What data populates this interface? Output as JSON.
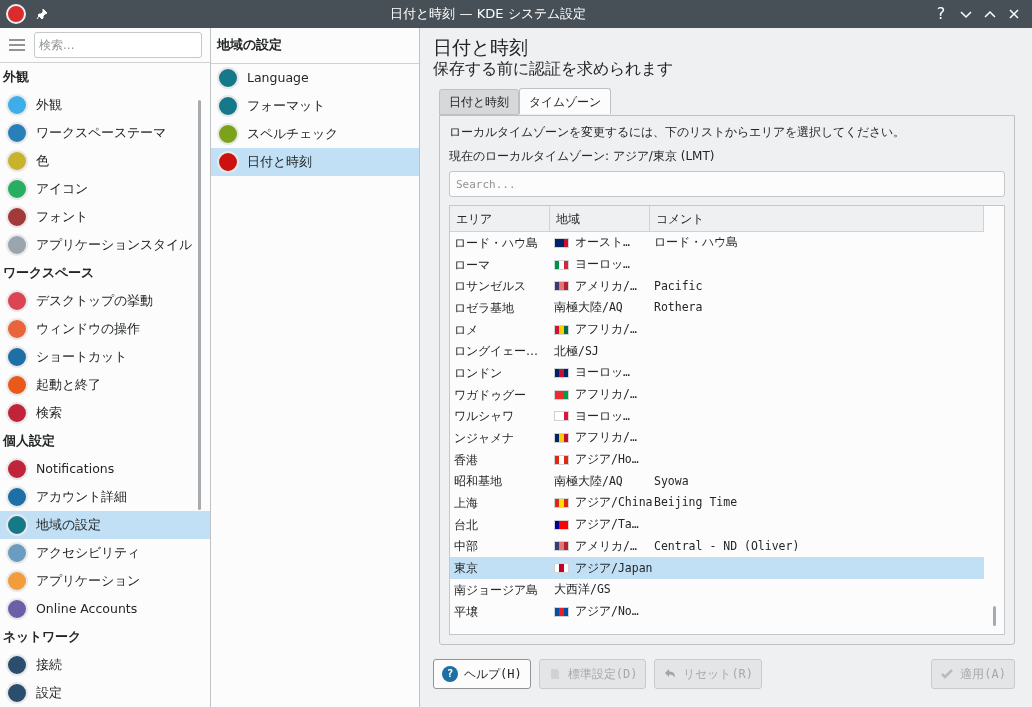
{
  "window": {
    "title": "日付と時刻 — KDE システム設定",
    "help_glyph": "?"
  },
  "sidebar": {
    "search_placeholder": "検索...",
    "sections": [
      {
        "heading": "外観",
        "items": [
          {
            "label": "外観",
            "color": "#3daee9",
            "selected": false
          },
          {
            "label": "ワークスペーステーマ",
            "color": "#2980b9",
            "selected": false
          },
          {
            "label": "色",
            "color": "#c9b22c",
            "selected": false
          },
          {
            "label": "アイコン",
            "color": "#27ae60",
            "selected": false
          },
          {
            "label": "フォント",
            "color": "#a33a3a",
            "selected": false
          },
          {
            "label": "アプリケーションスタイル",
            "color": "#9aa5ad",
            "selected": false
          }
        ]
      },
      {
        "heading": "ワークスペース",
        "items": [
          {
            "label": "デスクトップの挙動",
            "color": "#da4453",
            "selected": false
          },
          {
            "label": "ウィンドウの操作",
            "color": "#e9643a",
            "selected": false
          },
          {
            "label": "ショートカット",
            "color": "#1d6fa5",
            "selected": false
          },
          {
            "label": "起動と終了",
            "color": "#e8591a",
            "selected": false
          },
          {
            "label": "検索",
            "color": "#c0233a",
            "selected": false
          }
        ]
      },
      {
        "heading": "個人設定",
        "items": [
          {
            "label": "Notifications",
            "color": "#c0233a",
            "selected": false
          },
          {
            "label": "アカウント詳細",
            "color": "#1d6fa5",
            "selected": false
          },
          {
            "label": "地域の設定",
            "color": "#16798a",
            "selected": true
          },
          {
            "label": "アクセシビリティ",
            "color": "#6a9cc0",
            "selected": false
          },
          {
            "label": "アプリケーション",
            "color": "#f39c3c",
            "selected": false
          },
          {
            "label": "Online Accounts",
            "color": "#6b5fa8",
            "selected": false
          }
        ]
      },
      {
        "heading": "ネットワーク",
        "items": [
          {
            "label": "接続",
            "color": "#2c4e6e",
            "selected": false
          },
          {
            "label": "設定",
            "color": "#2c4e6e",
            "selected": false
          }
        ]
      }
    ]
  },
  "subpanel": {
    "title": "地域の設定",
    "items": [
      {
        "label": "Language",
        "color": "#16798a",
        "selected": false
      },
      {
        "label": "フォーマット",
        "color": "#16798a",
        "selected": false
      },
      {
        "label": "スペルチェック",
        "color": "#7ca11a",
        "selected": false
      },
      {
        "label": "日付と時刻",
        "color": "#cc1111",
        "selected": true
      }
    ]
  },
  "page": {
    "title": "日付と時刻",
    "subtitle": "保存する前に認証を求められます",
    "tabs": [
      {
        "label": "日付と時刻",
        "selected": false
      },
      {
        "label": "タイムゾーン",
        "selected": true
      }
    ],
    "instruction": "ローカルタイムゾーンを変更するには、下のリストからエリアを選択してください。",
    "current": "現在のローカルタイムゾーン: アジア/東京 (LMT)",
    "search_placeholder": "Search...",
    "table": {
      "columns": [
        "エリア",
        "地域",
        "コメント"
      ],
      "rows": [
        {
          "area": "ロード・ハウ島",
          "flag": [
            {
              "color": "#012169"
            },
            {
              "color": "#012169"
            },
            {
              "color": "#c8102e"
            }
          ],
          "region": "オースト…",
          "comment": "ロード・ハウ島",
          "selected": false
        },
        {
          "area": "ローマ",
          "flag": [
            {
              "color": "#009246"
            },
            {
              "color": "#ffffff"
            },
            {
              "color": "#ce2b37"
            }
          ],
          "region": "ヨーロッ…",
          "comment": "",
          "selected": false
        },
        {
          "area": "ロサンゼルス",
          "flag": [
            {
              "color": "#3c3b6e"
            },
            {
              "color": "#e57373"
            },
            {
              "color": "#b22234"
            }
          ],
          "region": "アメリカ/…",
          "comment": "Pacific",
          "selected": false
        },
        {
          "area": "ロゼラ基地",
          "region": "南極大陸/AQ",
          "comment": "Rothera",
          "selected": false
        },
        {
          "area": "ロメ",
          "flag": [
            {
              "color": "#d21034"
            },
            {
              "color": "#ffce00"
            },
            {
              "color": "#006a4e"
            }
          ],
          "region": "アフリカ/…",
          "comment": "",
          "selected": false
        },
        {
          "area": "ロングイェー…",
          "region": "北極/SJ",
          "comment": "",
          "selected": false
        },
        {
          "area": "ロンドン",
          "flag": [
            {
              "color": "#012169"
            },
            {
              "color": "#c8102e"
            },
            {
              "color": "#012169"
            }
          ],
          "region": "ヨーロッ…",
          "comment": "",
          "selected": false
        },
        {
          "area": "ワガドゥグー",
          "flag": [
            {
              "color": "#ef2b2d"
            },
            {
              "color": "#ef2b2d"
            },
            {
              "color": "#009e49"
            }
          ],
          "region": "アフリカ/…",
          "comment": "",
          "selected": false
        },
        {
          "area": "ワルシャワ",
          "flag": [
            {
              "color": "#ffffff"
            },
            {
              "color": "#ffffff"
            },
            {
              "color": "#dc143c"
            }
          ],
          "region": "ヨーロッ…",
          "comment": "",
          "selected": false
        },
        {
          "area": "ンジャメナ",
          "flag": [
            {
              "color": "#002664"
            },
            {
              "color": "#fecb00"
            },
            {
              "color": "#c60c30"
            }
          ],
          "region": "アフリカ/…",
          "comment": "",
          "selected": false
        },
        {
          "area": "香港",
          "flag": [
            {
              "color": "#de2910"
            },
            {
              "color": "#ffffff"
            },
            {
              "color": "#de2910"
            }
          ],
          "region": "アジア/Ho…",
          "comment": "",
          "selected": false
        },
        {
          "area": "昭和基地",
          "region": "南極大陸/AQ",
          "comment": "Syowa",
          "selected": false
        },
        {
          "area": "上海",
          "flag": [
            {
              "color": "#de2910"
            },
            {
              "color": "#ffde00"
            },
            {
              "color": "#de2910"
            }
          ],
          "region": "アジア/China",
          "comment": "Beijing Time",
          "selected": false
        },
        {
          "area": "台北",
          "flag": [
            {
              "color": "#000095"
            },
            {
              "color": "#fe0000"
            },
            {
              "color": "#fe0000"
            }
          ],
          "region": "アジア/Ta…",
          "comment": "",
          "selected": false
        },
        {
          "area": "中部",
          "flag": [
            {
              "color": "#3c3b6e"
            },
            {
              "color": "#e57373"
            },
            {
              "color": "#b22234"
            }
          ],
          "region": "アメリカ/…",
          "comment": "Central - ND (Oliver)",
          "selected": false
        },
        {
          "area": "東京",
          "flag": [
            {
              "color": "#ffffff"
            },
            {
              "color": "#bc002d"
            },
            {
              "color": "#ffffff"
            }
          ],
          "region": "アジア/Japan",
          "comment": "",
          "selected": true
        },
        {
          "area": "南ジョージア島",
          "region": "大西洋/GS",
          "comment": "",
          "selected": false
        },
        {
          "area": "平壌",
          "flag": [
            {
              "color": "#024fa2"
            },
            {
              "color": "#ed1c27"
            },
            {
              "color": "#024fa2"
            }
          ],
          "region": "アジア/No…",
          "comment": "",
          "selected": false
        }
      ]
    }
  },
  "buttons": [
    {
      "label": "ヘルプ(H)",
      "disabled": false,
      "kind": "help",
      "icon_text": "?"
    },
    {
      "label": "標準設定(D)",
      "disabled": true,
      "kind": "defaults"
    },
    {
      "label": "リセット(R)",
      "disabled": true,
      "kind": "reset"
    },
    {
      "label": "適用(A)",
      "disabled": true,
      "kind": "apply"
    }
  ]
}
